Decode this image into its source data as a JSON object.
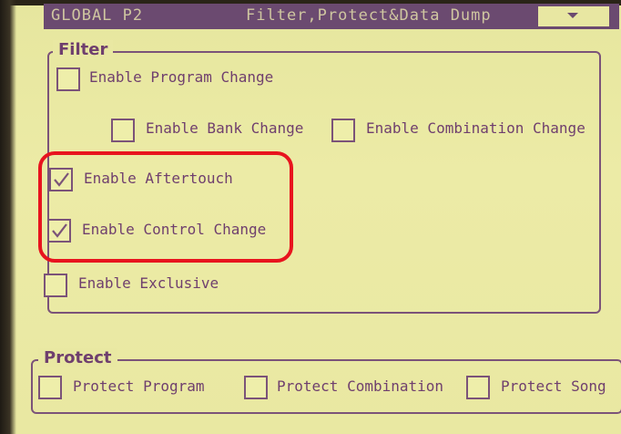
{
  "header": {
    "title": "GLOBAL P2",
    "subtitle": "Filter,Protect&Data Dump"
  },
  "filter": {
    "title": "Filter",
    "items": [
      {
        "label": "Enable Program Change",
        "checked": false
      },
      {
        "label": "Enable Bank Change",
        "checked": false
      },
      {
        "label": "Enable Combination Change",
        "checked": false
      },
      {
        "label": "Enable Aftertouch",
        "checked": true
      },
      {
        "label": "Enable Control Change",
        "checked": true
      },
      {
        "label": "Enable Exclusive",
        "checked": false
      }
    ]
  },
  "protect": {
    "title": "Protect",
    "items": [
      {
        "label": "Protect Program",
        "checked": false
      },
      {
        "label": "Protect Combination",
        "checked": false
      },
      {
        "label": "Protect Song",
        "checked": false
      }
    ]
  },
  "colors": {
    "screen_bg": "#e9e8a2",
    "text": "#6f3f6e",
    "header_bg": "#6b4a70",
    "highlight": "#e8141e"
  },
  "icons": {
    "check": "check-icon",
    "dropdown": "chevron-down-icon"
  }
}
